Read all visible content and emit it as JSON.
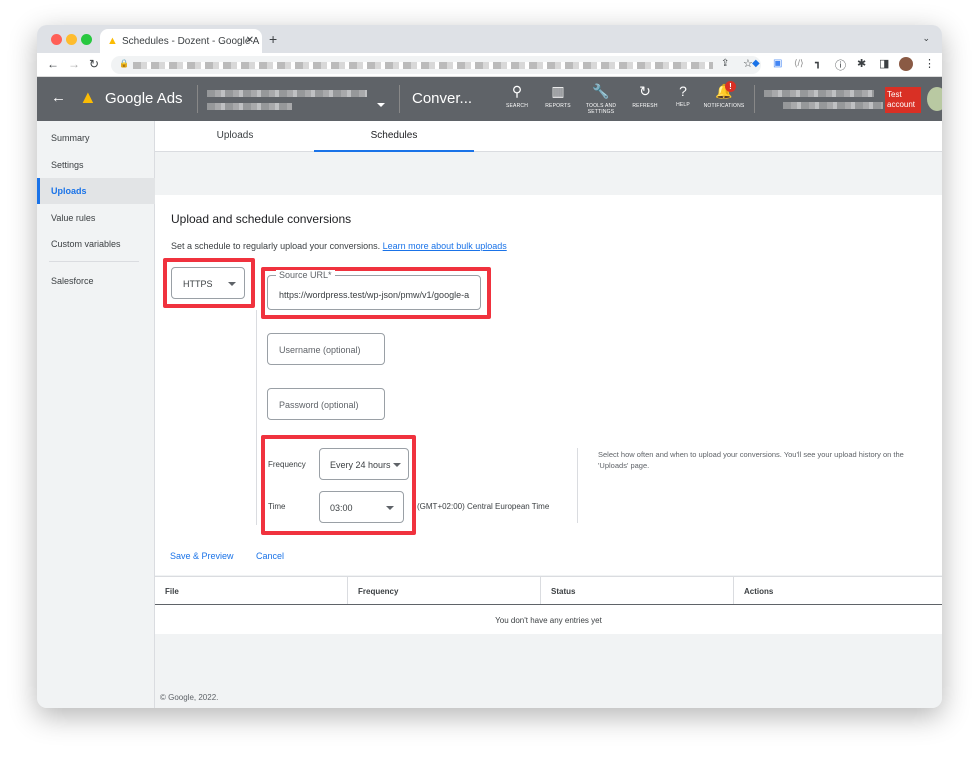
{
  "browser": {
    "tab_title": "Schedules - Dozent - Google A",
    "new_tab": "+"
  },
  "header": {
    "product": "Google Ads",
    "page": "Conver...",
    "icons": [
      {
        "label": "SEARCH",
        "glyph": "⚲"
      },
      {
        "label": "REPORTS",
        "glyph": "▥"
      },
      {
        "label": "TOOLS AND SETTINGS",
        "glyph": "🔧"
      },
      {
        "label": "REFRESH",
        "glyph": "↻"
      },
      {
        "label": "HELP",
        "glyph": "?"
      },
      {
        "label": "NOTIFICATIONS",
        "glyph": "🔔"
      }
    ],
    "badge": "!",
    "test_account": "Test account"
  },
  "sidebar": {
    "items": [
      "Summary",
      "Settings",
      "Uploads",
      "Value rules",
      "Custom variables",
      "Salesforce"
    ]
  },
  "tabs": [
    "Uploads",
    "Schedules"
  ],
  "form": {
    "title": "Upload and schedule conversions",
    "description": "Set a schedule to regularly upload your conversions.",
    "learn_more": "Learn more about bulk uploads",
    "source_type": "HTTPS",
    "source_url_label": "Source URL*",
    "source_url": "https://wordpress.test/wp-json/pmw/v1/google-a",
    "username_placeholder": "Username (optional)",
    "password_placeholder": "Password (optional)",
    "frequency_label": "Frequency",
    "frequency": "Every 24 hours",
    "time_label": "Time",
    "time": "03:00",
    "timezone": "(GMT+02:00) Central European Time",
    "help": "Select how often and when to upload your conversions. You'll see your upload history on the 'Uploads' page.",
    "save": "Save & Preview",
    "cancel": "Cancel"
  },
  "table": {
    "columns": [
      "File",
      "Frequency",
      "Status",
      "Actions"
    ],
    "empty": "You don't have any entries yet"
  },
  "footer": "© Google, 2022.",
  "colors": {
    "header": "#5f6368",
    "accent": "#1a73e8",
    "highlight": "#f0323e",
    "test_badge": "#d93025"
  }
}
